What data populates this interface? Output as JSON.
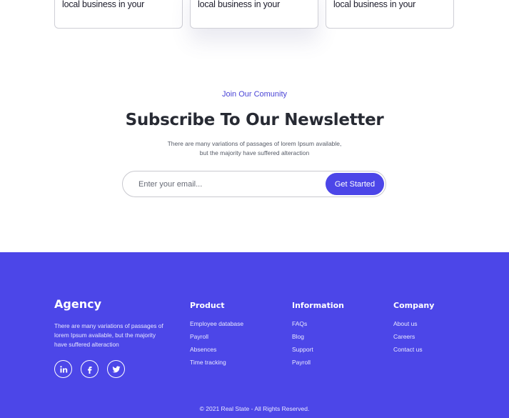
{
  "cards": [
    {
      "text": "local business in your"
    },
    {
      "text": "local business in your"
    },
    {
      "text": "local business in your"
    }
  ],
  "newsletter": {
    "eyebrow": "Join Our Comunity",
    "title": "Subscribe To Our Newsletter",
    "description_line1": "There are many variations of passages of lorem Ipsum available,",
    "description_line2": "but the majority have suffered alteraction",
    "email_placeholder": "Enter your email...",
    "button_label": "Get Started"
  },
  "footer": {
    "brand": "Agency",
    "brand_description": "There are many variations of passages of lorem Ipsum available, but the majority have suffered alteraction",
    "socials": [
      "linkedin-icon",
      "facebook-icon",
      "twitter-icon"
    ],
    "columns": {
      "product": {
        "title": "Product",
        "items": [
          "Employee database",
          "Payroll",
          "Absences",
          "Time tracking"
        ]
      },
      "information": {
        "title": "Information",
        "items": [
          "FAQs",
          "Blog",
          "Support",
          "Payroll"
        ]
      },
      "company": {
        "title": "Company",
        "items": [
          "About us",
          "Careers",
          "Contact us"
        ]
      }
    },
    "copyright": "© 2021 Real State - All Rights Reserved."
  },
  "colors": {
    "accent": "#4c46e8",
    "heading": "#272a33",
    "eyebrow": "#4a44d6"
  }
}
